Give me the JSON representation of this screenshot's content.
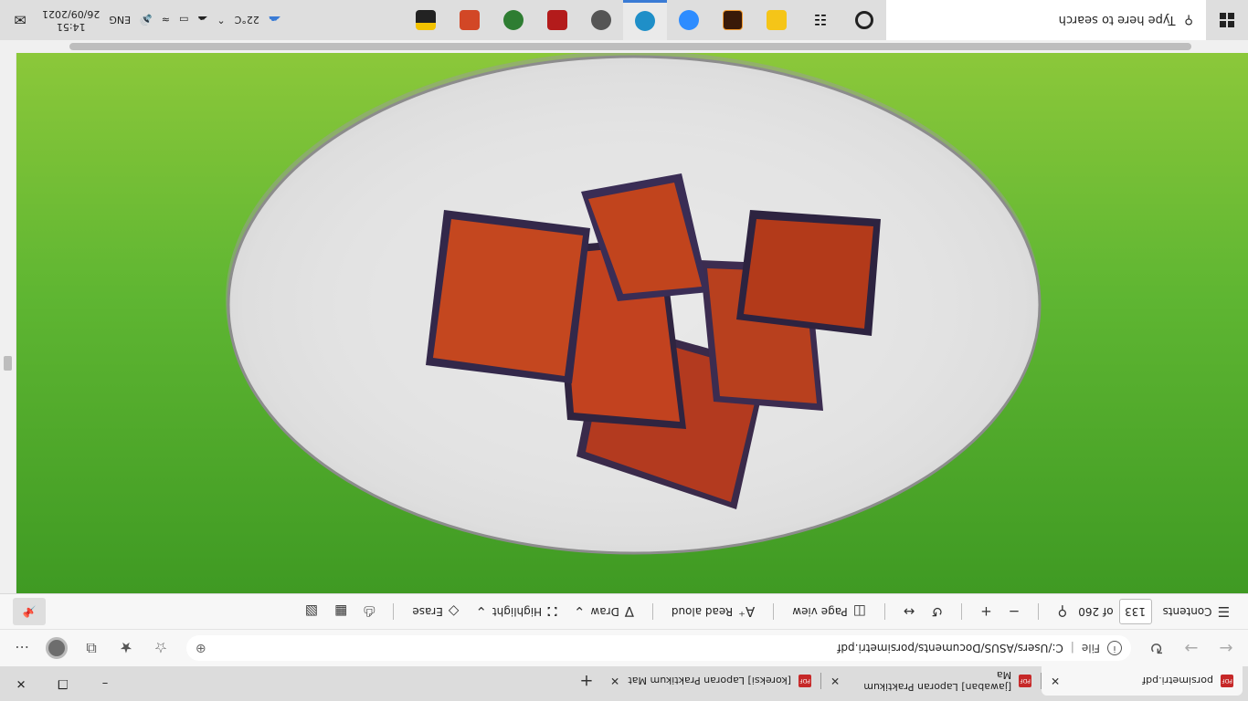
{
  "browser": {
    "tabs": [
      {
        "label": "porsimetri.pdf",
        "active": true
      },
      {
        "label": "[jawaban] Laporan Praktikum Ma",
        "active": false
      },
      {
        "label": "[koreksi] Laporan Praktikum Mat",
        "active": false
      }
    ],
    "new_tab_label": "+",
    "window_buttons": [
      "–",
      "❐",
      "✕"
    ],
    "address": {
      "scheme_label": "File",
      "url": "C:/Users/ASUS/Documents/porsimetri.pdf"
    }
  },
  "pdf_toolbar": {
    "contents_label": "Contents",
    "page_current": "133",
    "page_total": "of 260",
    "page_view_label": "Page view",
    "read_aloud_label": "Read aloud",
    "draw_label": "Draw",
    "highlight_label": "Highlight",
    "erase_label": "Erase"
  },
  "taskbar": {
    "search_placeholder": "Type here to search",
    "weather": "22°C",
    "language": "ENG",
    "time": "14:51",
    "date": "26/09/2021"
  },
  "colors": {
    "accent": "#3a7bd5",
    "pdf_red": "#c62828",
    "bg_green": "#4caf2a",
    "plate": "#e9e9e9"
  },
  "icons": [
    "search-icon",
    "windows-start-icon",
    "cortana-icon",
    "task-view-icon",
    "edge-icon",
    "zoom-icon",
    "info-icon",
    "refresh-icon"
  ]
}
